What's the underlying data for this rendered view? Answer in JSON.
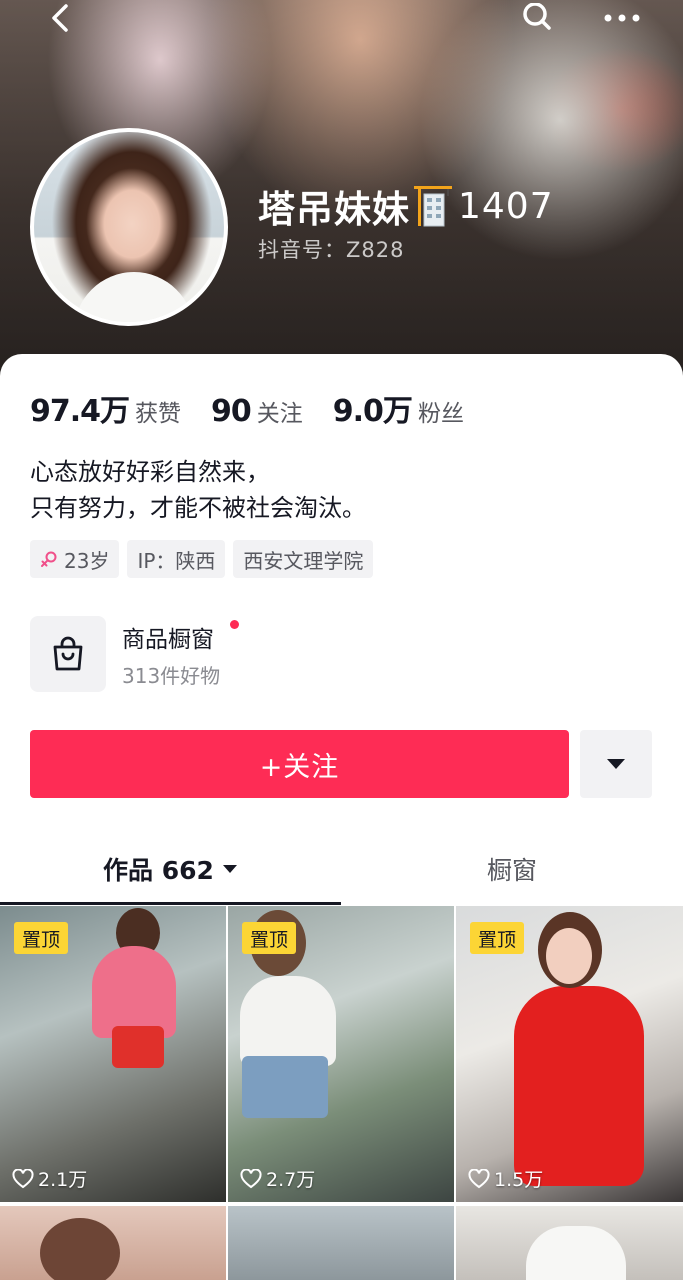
{
  "header": {
    "nickname": "塔吊妹妹",
    "nickname_suffix": "1407",
    "badge_icon": "crane-building-icon",
    "douyin_id": "抖音号：Z828"
  },
  "nav": {
    "back_icon": "chevron-left-icon",
    "search_icon": "search-icon",
    "more_icon": "more-dots-icon"
  },
  "stats": [
    {
      "value": "97.4万",
      "label": "获赞"
    },
    {
      "value": "90",
      "label": "关注"
    },
    {
      "value": "9.0万",
      "label": "粉丝"
    }
  ],
  "bio": {
    "line1": "心态放好好彩自然来，",
    "line2": "只有努力，才能不被社会淘汰。"
  },
  "tags": {
    "age": "23岁",
    "ip": "IP：陕西",
    "school": "西安文理学院"
  },
  "shop": {
    "title": "商品橱窗",
    "subtitle": "313件好物"
  },
  "actions": {
    "follow_label": "+关注"
  },
  "tabs": {
    "works_label": "作品 662",
    "window_label": "橱窗"
  },
  "videos": [
    {
      "pinned_label": "置顶",
      "likes": "2.1万"
    },
    {
      "pinned_label": "置顶",
      "likes": "2.7万"
    },
    {
      "pinned_label": "置顶",
      "likes": "1.5万"
    }
  ],
  "colors": {
    "accent": "#fe2c55",
    "pin_badge": "#fcd535",
    "text_primary": "#161823",
    "text_secondary": "#57585f"
  }
}
